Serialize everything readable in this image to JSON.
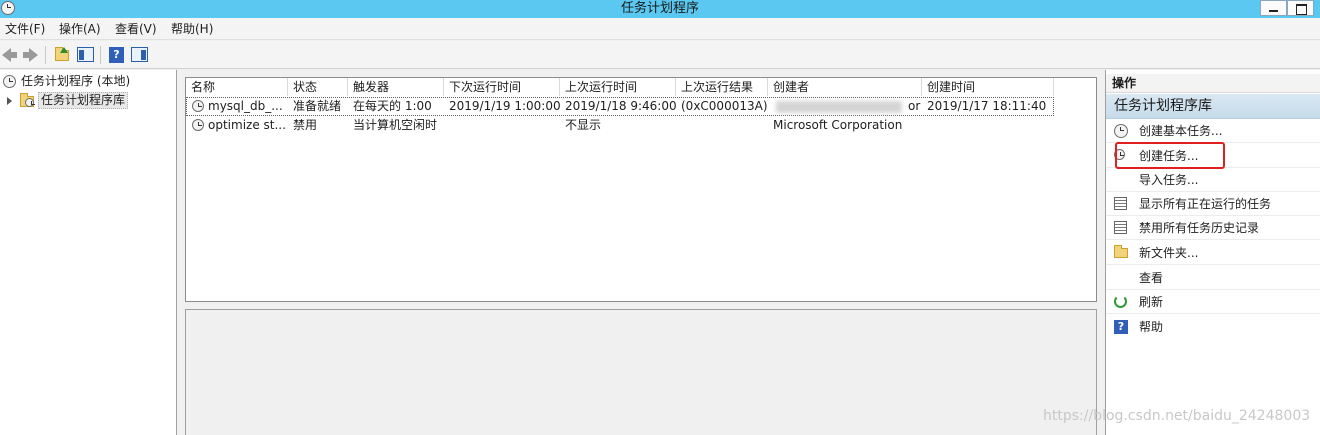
{
  "window": {
    "title": "任务计划程序"
  },
  "menu": {
    "items": [
      "文件(F)",
      "操作(A)",
      "查看(V)",
      "帮助(H)"
    ]
  },
  "toolbar": {
    "icons": [
      "back-icon",
      "forward-icon",
      "folder-up-icon",
      "show-console-tree-icon",
      "help-icon",
      "show-action-pane-icon"
    ]
  },
  "tree": {
    "root": "任务计划程序 (本地)",
    "child": "任务计划程序库"
  },
  "tasks": {
    "columns": [
      "名称",
      "状态",
      "触发器",
      "下次运行时间",
      "上次运行时间",
      "上次运行结果",
      "创建者",
      "创建时间"
    ],
    "rows": [
      {
        "name": "mysql_db_...",
        "status": "准备就绪",
        "trigger": "在每天的 1:00",
        "next_run": "2019/1/19 1:00:00",
        "last_run": "2019/1/18 9:46:00",
        "last_result": "(0xC000013A)",
        "author_suffix": "or",
        "created": "2019/1/17 18:11:40"
      },
      {
        "name": "optimize st...",
        "status": "禁用",
        "trigger": "当计算机空闲时",
        "next_run": "",
        "last_run": "不显示",
        "last_result": "",
        "author": "Microsoft Corporation",
        "created": ""
      }
    ]
  },
  "actions": {
    "header": "操作",
    "section": "任务计划程序库",
    "items": [
      {
        "label": "创建基本任务...",
        "icon": "create-basic-task-icon"
      },
      {
        "label": "创建任务...",
        "icon": "create-task-icon"
      },
      {
        "label": "导入任务...",
        "icon": ""
      },
      {
        "label": "显示所有正在运行的任务",
        "icon": "running-tasks-icon"
      },
      {
        "label": "禁用所有任务历史记录",
        "icon": "history-icon"
      },
      {
        "label": "新文件夹...",
        "icon": "new-folder-icon"
      },
      {
        "label": "查看",
        "icon": ""
      },
      {
        "label": "刷新",
        "icon": "refresh-icon"
      },
      {
        "label": "帮助",
        "icon": "help-icon"
      }
    ]
  },
  "watermark": "https://blog.csdn.net/baidu_24248003",
  "colors": {
    "titlebar": "#5ac8f0",
    "highlight": "#e02020",
    "section": "#c6dbea"
  }
}
